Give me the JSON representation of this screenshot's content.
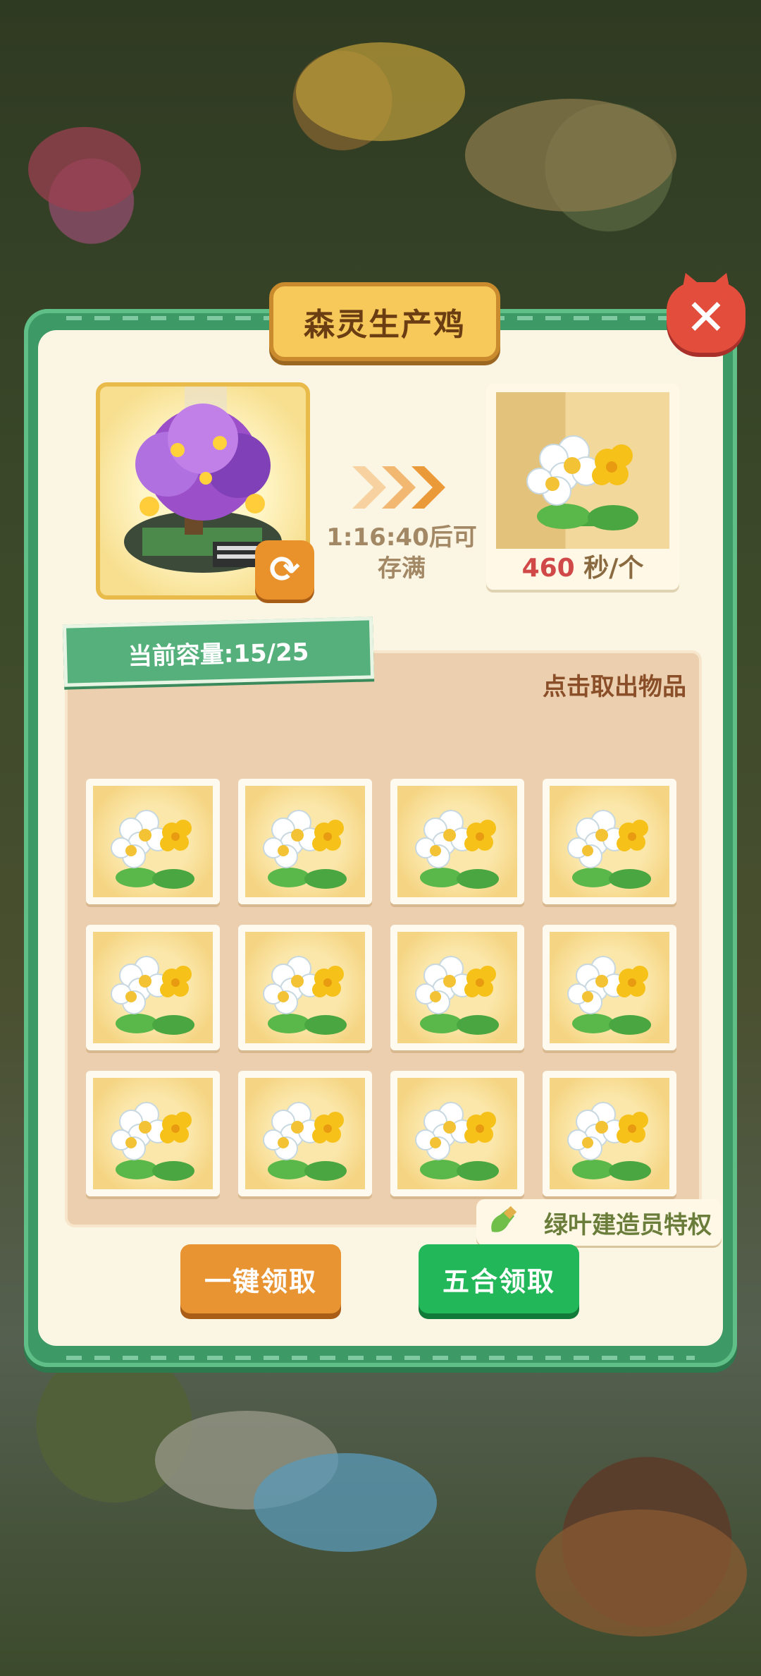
{
  "dialog": {
    "title": "森灵生产鸡",
    "close_label": "✕"
  },
  "production": {
    "timer_text": "1:16:40后可存满",
    "rate_value": "460",
    "rate_unit": "秒/个"
  },
  "storage": {
    "capacity_label": "当前容量:15/25",
    "hint": "点击取出物品",
    "items": [
      {
        "name": "flower"
      },
      {
        "name": "flower"
      },
      {
        "name": "flower"
      },
      {
        "name": "flower"
      },
      {
        "name": "flower"
      },
      {
        "name": "flower"
      },
      {
        "name": "flower"
      },
      {
        "name": "flower"
      },
      {
        "name": "flower"
      },
      {
        "name": "flower"
      },
      {
        "name": "flower"
      },
      {
        "name": "flower"
      }
    ]
  },
  "privilege": {
    "label": "绿叶建造员特权"
  },
  "buttons": {
    "collect_all": "一键领取",
    "merge_collect": "五合领取"
  },
  "colors": {
    "panel_green": "#3d9a66",
    "close_red": "#e34d3c",
    "collect_orange": "#e99432",
    "merge_green": "#22b85a"
  }
}
